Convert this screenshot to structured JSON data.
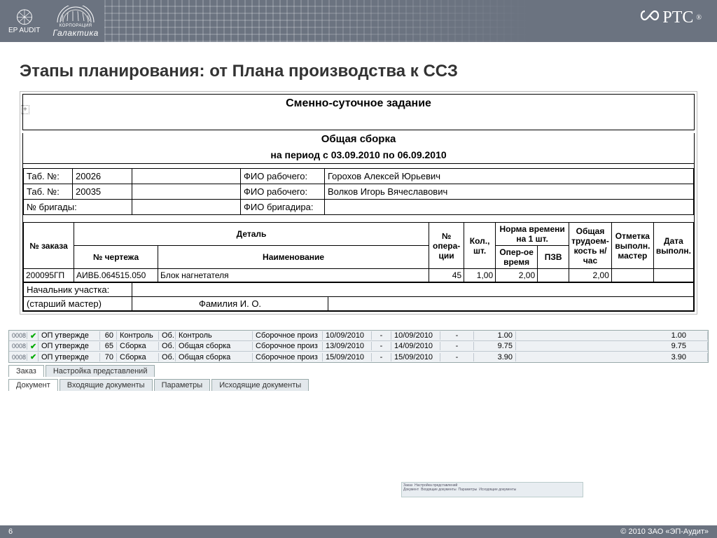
{
  "header": {
    "logo1_text": "EP AUDIT",
    "logo2_text": "Галактика",
    "logo2_sub": "КОРПОРАЦИЯ",
    "ptc": "PTC",
    "ptc_reg": "®"
  },
  "slide": {
    "title": "Этапы планирования: от Плана производства к ССЗ",
    "anchor": "+"
  },
  "doc": {
    "title": "Сменно-суточное задание",
    "section": "Общая сборка",
    "period": "на период с 03.09.2010 по 06.09.2010",
    "rows": [
      {
        "l1": "Таб. №:",
        "v1": "20026",
        "l2": "ФИО рабочего:",
        "v2": "Горохов Алексей Юрьевич"
      },
      {
        "l1": "Таб. №:",
        "v1": "20035",
        "l2": "ФИО рабочего:",
        "v2": "Волков Игорь Вячеславович"
      },
      {
        "l1": "№ бригады:",
        "v1": "",
        "l2": "ФИО бригадира:",
        "v2": ""
      }
    ],
    "cols": {
      "order": "№ заказа",
      "part": "Деталь",
      "drawing": "№ чертежа",
      "name": "Наименование",
      "op": "№ опера-ции",
      "qty": "Кол., шт.",
      "norm": "Норма времени на 1 шт.",
      "oper": "Опер-ое время",
      "pzv": "ПЗВ",
      "labor": "Общая трудоем-кость н/час",
      "mark": "Отметка выполн. мастер",
      "date": "Дата выполн."
    },
    "data": {
      "order": "200095ГП",
      "drawing": "АИВБ.064515.050",
      "name": "Блок нагнетателя",
      "op": "45",
      "qty": "1,00",
      "oper": "2,00",
      "pzv": "",
      "labor": "2,00",
      "mark": "",
      "date": ""
    },
    "foot": {
      "l1": "Начальник участка:",
      "l2": "(старший мастер)",
      "fio": "Фамилия И. О."
    }
  },
  "grid": {
    "rows": [
      {
        "idx": "0008",
        "stat": "ОП утвержде",
        "num": "60",
        "type": "Контроль",
        "ob": "Об.",
        "name": "Контроль",
        "dep": "Сборочное произ",
        "d1": "10/09/2010",
        "dash": "-",
        "d2": "10/09/2010",
        "dash2": "-",
        "v1": "1.00",
        "v2": "1.00"
      },
      {
        "idx": "0008",
        "stat": "ОП утвержде",
        "num": "65",
        "type": "Сборка",
        "ob": "Об.",
        "name": "Общая сборка",
        "dep": "Сборочное произ",
        "d1": "13/09/2010",
        "dash": "-",
        "d2": "14/09/2010",
        "dash2": "-",
        "v1": "9.75",
        "v2": "9.75"
      },
      {
        "idx": "0008",
        "stat": "ОП утвержде",
        "num": "70",
        "type": "Сборка",
        "ob": "Об.",
        "name": "Общая сборка",
        "dep": "Сборочное произ",
        "d1": "15/09/2010",
        "dash": "-",
        "d2": "15/09/2010",
        "dash2": "-",
        "v1": "3.90",
        "v2": "3.90"
      }
    ],
    "tabs1": [
      "Заказ",
      "Настройка представлений"
    ],
    "tabs2": [
      "Документ",
      "Входящие документы",
      "Параметры",
      "Исходящие документы"
    ]
  },
  "footer": {
    "page": "6",
    "copyright": "© 2010 ЗАО «ЭП-Аудит»"
  }
}
